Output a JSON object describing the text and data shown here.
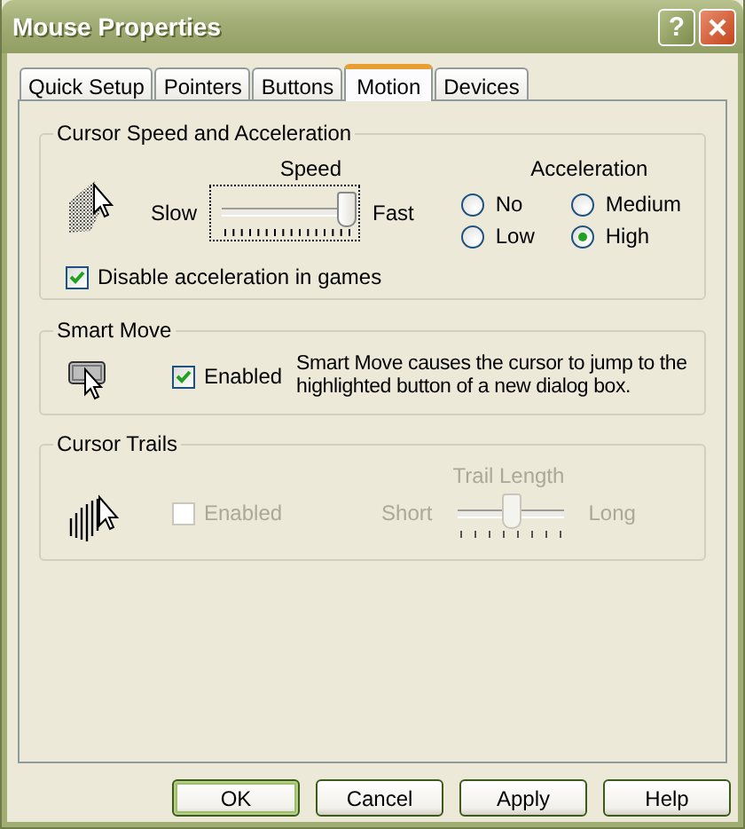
{
  "window": {
    "title": "Mouse Properties",
    "help_button": "?"
  },
  "tabs": [
    {
      "label": "Quick Setup",
      "selected": false
    },
    {
      "label": "Pointers",
      "selected": false
    },
    {
      "label": "Buttons",
      "selected": false
    },
    {
      "label": "Motion",
      "selected": true
    },
    {
      "label": "Devices",
      "selected": false
    }
  ],
  "speed_group": {
    "title": "Cursor Speed and Acceleration",
    "speed_label": "Speed",
    "slow_label": "Slow",
    "fast_label": "Fast",
    "level": 0.95,
    "acceleration_label": "Acceleration",
    "acceleration_options": [
      {
        "label": "No",
        "selected": false
      },
      {
        "label": "Medium",
        "selected": false
      },
      {
        "label": "Low",
        "selected": false
      },
      {
        "label": "High",
        "selected": true
      }
    ],
    "game_checkbox": {
      "label": "Disable acceleration in games",
      "checked": true
    }
  },
  "smart_move": {
    "title": "Smart Move",
    "checkbox": {
      "label": "Enabled",
      "checked": true
    },
    "description": "Smart Move causes the cursor to jump to the highlighted button of a new dialog box."
  },
  "cursor_trails": {
    "title": "Cursor Trails",
    "disabled": true,
    "checkbox": {
      "label": "Enabled",
      "checked": false
    },
    "trail_length_label": "Trail Length",
    "short_label": "Short",
    "long_label": "Long",
    "level": 0.5
  },
  "buttons": [
    {
      "label": "OK",
      "default": true
    },
    {
      "label": "Cancel",
      "default": false
    },
    {
      "label": "Apply",
      "default": false
    },
    {
      "label": "Help",
      "default": false
    }
  ]
}
